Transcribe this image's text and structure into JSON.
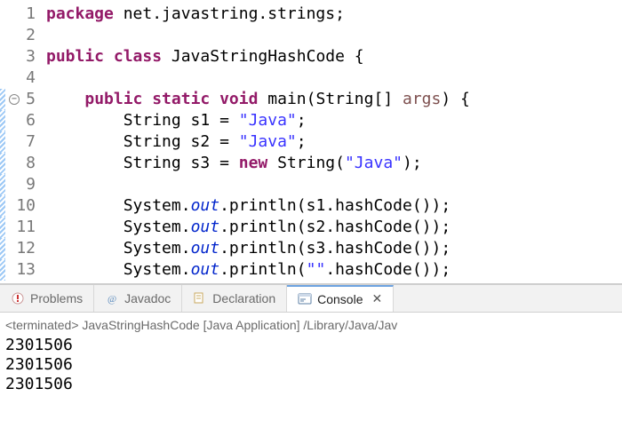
{
  "code": {
    "lines": [
      {
        "num": "1",
        "changed": false,
        "fold": false,
        "tokens": [
          [
            "kw",
            "package"
          ],
          [
            "plain",
            " net.javastring.strings;"
          ]
        ]
      },
      {
        "num": "2",
        "changed": false,
        "fold": false,
        "tokens": []
      },
      {
        "num": "3",
        "changed": false,
        "fold": false,
        "tokens": [
          [
            "kw",
            "public class"
          ],
          [
            "plain",
            " JavaStringHashCode {"
          ]
        ]
      },
      {
        "num": "4",
        "changed": false,
        "fold": false,
        "tokens": []
      },
      {
        "num": "5",
        "changed": true,
        "fold": true,
        "tokens": [
          [
            "plain",
            "    "
          ],
          [
            "kw",
            "public static void"
          ],
          [
            "plain",
            " main(String[] "
          ],
          [
            "param",
            "args"
          ],
          [
            "plain",
            ") {"
          ]
        ]
      },
      {
        "num": "6",
        "changed": true,
        "fold": false,
        "tokens": [
          [
            "plain",
            "        String s1 = "
          ],
          [
            "str",
            "\"Java\""
          ],
          [
            "plain",
            ";"
          ]
        ]
      },
      {
        "num": "7",
        "changed": true,
        "fold": false,
        "tokens": [
          [
            "plain",
            "        String s2 = "
          ],
          [
            "str",
            "\"Java\""
          ],
          [
            "plain",
            ";"
          ]
        ]
      },
      {
        "num": "8",
        "changed": true,
        "fold": false,
        "tokens": [
          [
            "plain",
            "        String s3 = "
          ],
          [
            "kw",
            "new"
          ],
          [
            "plain",
            " String("
          ],
          [
            "str",
            "\"Java\""
          ],
          [
            "plain",
            ");"
          ]
        ]
      },
      {
        "num": "9",
        "changed": true,
        "fold": false,
        "tokens": []
      },
      {
        "num": "10",
        "changed": true,
        "fold": false,
        "tokens": [
          [
            "plain",
            "        System."
          ],
          [
            "field",
            "out"
          ],
          [
            "plain",
            ".println(s1.hashCode());"
          ]
        ]
      },
      {
        "num": "11",
        "changed": true,
        "fold": false,
        "tokens": [
          [
            "plain",
            "        System."
          ],
          [
            "field",
            "out"
          ],
          [
            "plain",
            ".println(s2.hashCode());"
          ]
        ]
      },
      {
        "num": "12",
        "changed": true,
        "fold": false,
        "tokens": [
          [
            "plain",
            "        System."
          ],
          [
            "field",
            "out"
          ],
          [
            "plain",
            ".println(s3.hashCode());"
          ]
        ]
      },
      {
        "num": "13",
        "changed": true,
        "fold": false,
        "tokens": [
          [
            "plain",
            "        System."
          ],
          [
            "field",
            "out"
          ],
          [
            "plain",
            ".println("
          ],
          [
            "str",
            "\"\""
          ],
          [
            "plain",
            ".hashCode());"
          ]
        ]
      }
    ]
  },
  "tabs": {
    "problems": "Problems",
    "javadoc": "Javadoc",
    "declaration": "Declaration",
    "console": "Console"
  },
  "console": {
    "header": "<terminated> JavaStringHashCode [Java Application] /Library/Java/Jav",
    "output": [
      "2301506",
      "2301506",
      "2301506"
    ]
  }
}
